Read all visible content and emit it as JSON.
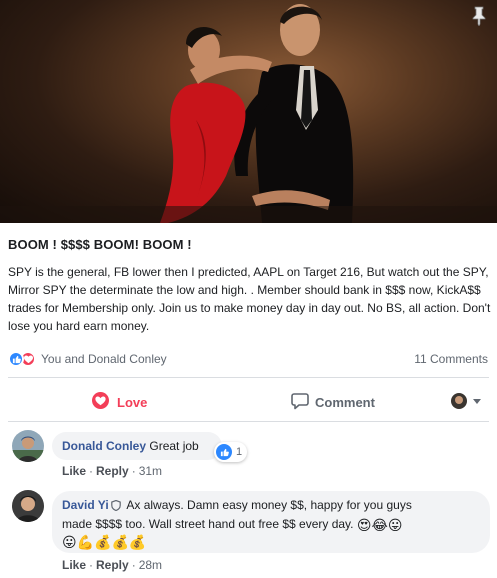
{
  "post": {
    "title": "BOOM ! $$$$  BOOM! BOOM !",
    "body": "SPY is the general, FB lower then I predicted, AAPL on Target 216, But watch out the SPY, Mirror SPY the  determinate the low and high. . Member should bank in $$$  now, KickA$$ trades for  Membership only. Join us to make money day in day out. No BS, all action. Don't lose you hard earn money."
  },
  "reactions": {
    "icons": [
      "like-icon",
      "love-icon"
    ],
    "summary": "You and Donald Conley",
    "comments_count": "11 Comments"
  },
  "actions": {
    "love_label": "Love",
    "comment_label": "Comment"
  },
  "colors": {
    "love": "#f33e58",
    "like": "#2d88ff",
    "link": "#385898",
    "muted": "#606770"
  },
  "comments": [
    {
      "author": "Donald Conley",
      "text": "Great job",
      "reaction_count": "1",
      "like_label": "Like",
      "reply_label": "Reply",
      "separator": "·",
      "time": "31m"
    },
    {
      "author": "David Yi",
      "line1": "Ax always. Damn easy money $$, happy for you guys",
      "line2": "made $$$$ too. Wall street hand out free $$ every day.",
      "line2_emojis": [
        "😍",
        "😂",
        "😛"
      ],
      "line3_emojis": [
        "😛",
        "💪",
        "💰",
        "💰",
        "💰"
      ],
      "like_label": "Like",
      "reply_label": "Reply",
      "separator": "·",
      "time": "28m"
    }
  ]
}
